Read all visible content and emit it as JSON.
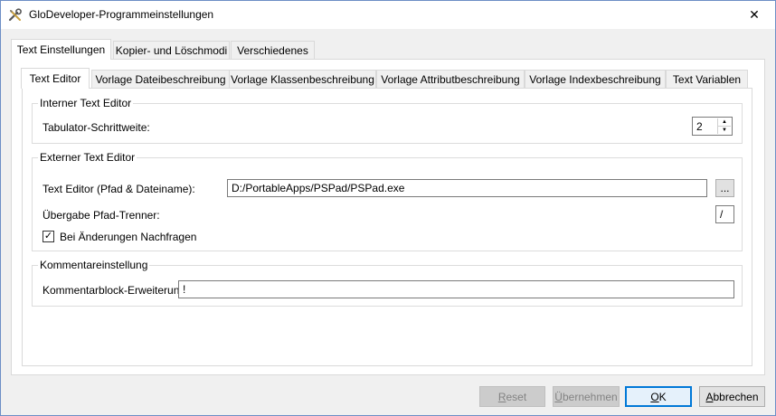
{
  "window": {
    "title": "GloDeveloper-Programmeinstellungen",
    "close_symbol": "✕"
  },
  "outer_tabs": [
    {
      "label": "Text Einstellungen",
      "active": true
    },
    {
      "label": "Kopier- und Löschmodi",
      "active": false
    },
    {
      "label": "Verschiedenes",
      "active": false
    }
  ],
  "inner_tabs": [
    {
      "label": "Text Editor",
      "active": true
    },
    {
      "label": "Vorlage Dateibeschreibung",
      "active": false
    },
    {
      "label": "Vorlage Klassenbeschreibung",
      "active": false
    },
    {
      "label": "Vorlage Attributbeschreibung",
      "active": false
    },
    {
      "label": "Vorlage Indexbeschreibung",
      "active": false
    },
    {
      "label": "Text Variablen",
      "active": false
    }
  ],
  "internal_editor": {
    "title": "Interner Text Editor",
    "tab_width_label": "Tabulator-Schrittweite:",
    "tab_width_value": "2"
  },
  "external_editor": {
    "title": "Externer Text Editor",
    "path_label": "Text Editor (Pfad & Dateiname):",
    "path_value": "D:/PortableApps/PSPad/PSPad.exe",
    "browse_label": "...",
    "separator_label": "Übergabe Pfad-Trenner:",
    "separator_value": "/",
    "confirm_label": "Bei Änderungen Nachfragen",
    "confirm_checked": true
  },
  "comment_settings": {
    "title": "Kommentareinstellung",
    "extension_label": "Kommentarblock-Erweiterung:",
    "extension_value": "!"
  },
  "buttons": {
    "reset_first": "R",
    "reset_rest": "eset",
    "apply_first": "Ü",
    "apply_rest": "bernehmen",
    "ok_first": "O",
    "ok_rest": "K",
    "cancel_first": "A",
    "cancel_rest": "bbrechen"
  },
  "icons": {
    "app": "tools-icon",
    "close": "close-icon",
    "spin_up": "chevron-up-icon",
    "spin_down": "chevron-down-icon",
    "check": "checkmark-icon"
  }
}
